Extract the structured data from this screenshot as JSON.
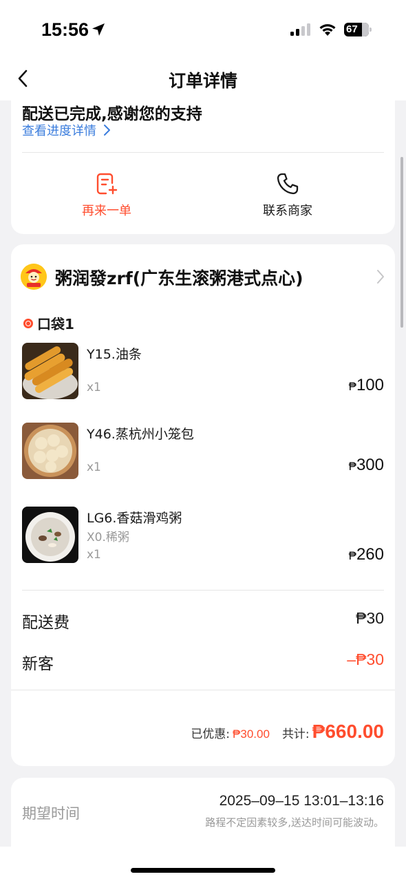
{
  "status_bar": {
    "time": "15:56",
    "battery": "67"
  },
  "nav": {
    "title": "订单详情"
  },
  "delivery": {
    "status": "配送已完成,感谢您的支持",
    "progress_link": "查看进度详情",
    "actions": [
      {
        "label": "再来一单",
        "icon": "reorder-icon",
        "color": "#ff4d2e"
      },
      {
        "label": "联系商家",
        "icon": "phone-icon",
        "color": "#1a1a1a"
      }
    ]
  },
  "order": {
    "shop_name": "粥润發zrf(广东生滚粥港式点心)",
    "bag_label": "口袋1",
    "currency": "₱",
    "items": [
      {
        "name": "Y15.油条",
        "spec": "",
        "qty": "x1",
        "price": "100"
      },
      {
        "name": "Y46.蒸杭州小笼包",
        "spec": "",
        "qty": "x1",
        "price": "300"
      },
      {
        "name": "LG6.香菇滑鸡粥",
        "spec": "X0.稀粥",
        "qty": "x1",
        "price": "260"
      }
    ],
    "fees": [
      {
        "label": "配送费",
        "value": "₱30",
        "color": "#1a1a1a"
      },
      {
        "label": "新客",
        "value": "–₱30",
        "color": "#ff4d2e"
      }
    ],
    "summary": {
      "discount_label": "已优惠:",
      "discount_value": "₱30.00",
      "total_label": "共计:",
      "total_value": "₱660.00"
    }
  },
  "expected": {
    "label": "期望时间",
    "value": "2025–09–15 13:01–13:16",
    "note": "路程不定因素较多,送达时间可能波动。"
  },
  "colors": {
    "accent": "#ff4d2e",
    "link": "#3b7ddd",
    "background": "#f2f2f4"
  }
}
